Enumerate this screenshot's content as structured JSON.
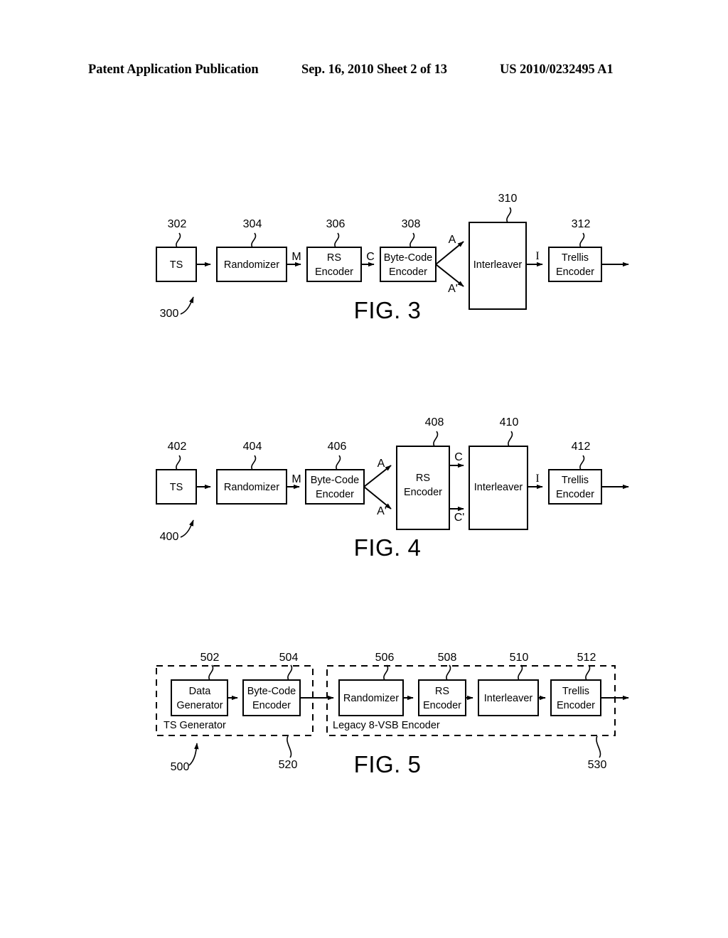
{
  "header": {
    "left": "Patent Application Publication",
    "middle": "Sep. 16, 2010   Sheet 2 of 13",
    "right": "US 2010/0232495 A1"
  },
  "figures": [
    {
      "id": "fig3",
      "title": "FIG. 3",
      "system_ref": "300",
      "blocks": [
        {
          "ref": "302",
          "label_line1": "TS",
          "label_line2": ""
        },
        {
          "ref": "304",
          "label_line1": "Randomizer",
          "label_line2": ""
        },
        {
          "ref": "306",
          "label_line1": "RS",
          "label_line2": "Encoder"
        },
        {
          "ref": "308",
          "label_line1": "Byte-Code",
          "label_line2": "Encoder"
        },
        {
          "ref": "310",
          "label_line1": "Interleaver",
          "label_line2": ""
        },
        {
          "ref": "312",
          "label_line1": "Trellis",
          "label_line2": "Encoder"
        }
      ],
      "signals": [
        {
          "name": "M"
        },
        {
          "name": "C"
        },
        {
          "name": "A"
        },
        {
          "name": "A'"
        },
        {
          "name": "I"
        }
      ]
    },
    {
      "id": "fig4",
      "title": "FIG. 4",
      "system_ref": "400",
      "blocks": [
        {
          "ref": "402",
          "label_line1": "TS",
          "label_line2": ""
        },
        {
          "ref": "404",
          "label_line1": "Randomizer",
          "label_line2": ""
        },
        {
          "ref": "406",
          "label_line1": "Byte-Code",
          "label_line2": "Encoder"
        },
        {
          "ref": "408",
          "label_line1": "RS",
          "label_line2": "Encoder"
        },
        {
          "ref": "410",
          "label_line1": "Interleaver",
          "label_line2": ""
        },
        {
          "ref": "412",
          "label_line1": "Trellis",
          "label_line2": "Encoder"
        }
      ],
      "signals": [
        {
          "name": "M"
        },
        {
          "name": "A"
        },
        {
          "name": "A'"
        },
        {
          "name": "C"
        },
        {
          "name": "C'"
        },
        {
          "name": "I"
        }
      ]
    },
    {
      "id": "fig5",
      "title": "FIG. 5",
      "system_ref": "500",
      "groups": [
        {
          "ref": "520",
          "label": "TS Generator"
        },
        {
          "ref": "530",
          "label": "Legacy 8-VSB Encoder"
        }
      ],
      "blocks": [
        {
          "ref": "502",
          "label_line1": "Data",
          "label_line2": "Generator"
        },
        {
          "ref": "504",
          "label_line1": "Byte-Code",
          "label_line2": "Encoder"
        },
        {
          "ref": "506",
          "label_line1": "Randomizer",
          "label_line2": ""
        },
        {
          "ref": "508",
          "label_line1": "RS",
          "label_line2": "Encoder"
        },
        {
          "ref": "510",
          "label_line1": "Interleaver",
          "label_line2": ""
        },
        {
          "ref": "512",
          "label_line1": "Trellis",
          "label_line2": "Encoder"
        }
      ]
    }
  ]
}
